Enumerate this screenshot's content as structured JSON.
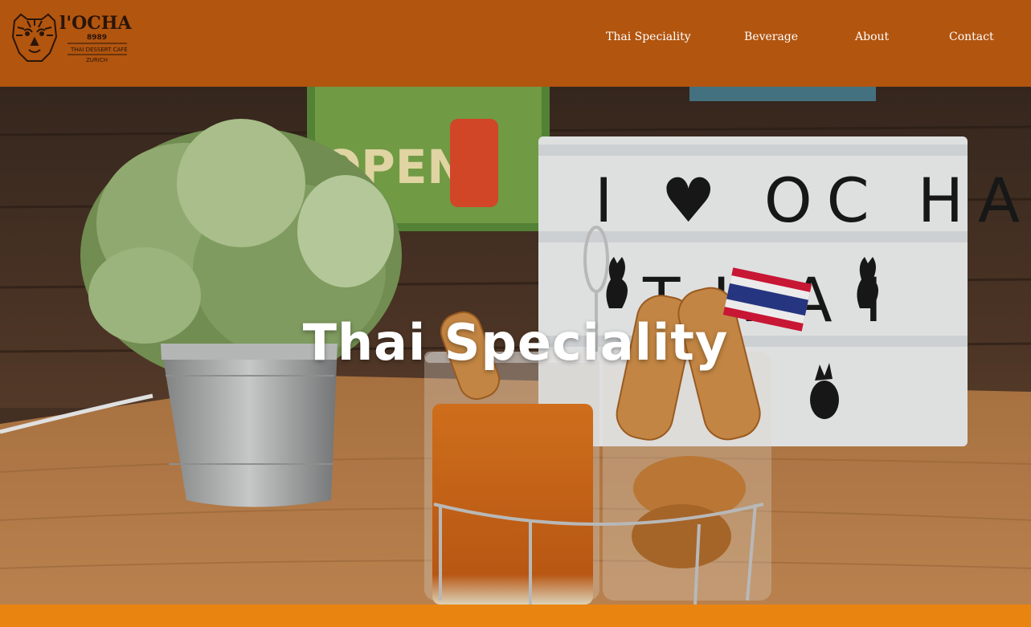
{
  "brand": {
    "name": "l'OCHA",
    "number": "8989",
    "tagline": "THAI DESSERT CAFÉ",
    "city": "ZURICH",
    "logo_icon": "tiger-head-icon"
  },
  "nav": {
    "items": [
      {
        "label": "Thai Speciality"
      },
      {
        "label": "Beverage"
      },
      {
        "label": "About"
      },
      {
        "label": "Contact"
      }
    ]
  },
  "hero": {
    "title": "Thai Speciality",
    "lightbox_line1": "I ♥ OC HA",
    "lightbox_line2": "THAI",
    "open_sign": "OPEN"
  },
  "colors": {
    "header": "#b2550f",
    "footer_strip": "#ea8410",
    "text": "#ffffff"
  }
}
